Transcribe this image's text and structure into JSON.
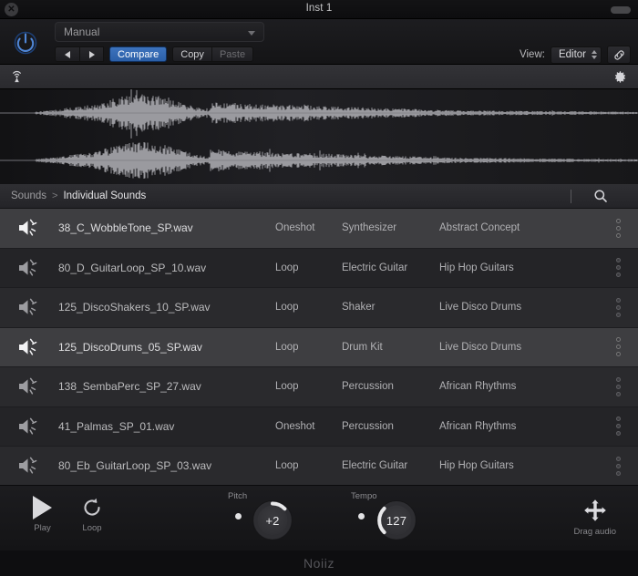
{
  "window": {
    "title": "Inst 1",
    "close_icon": "close-circle-icon",
    "resize_icon": "resize-pill-icon"
  },
  "plugin_header": {
    "power_icon": "power-icon",
    "preset": {
      "value": "Manual",
      "caret_icon": "chevron-down-icon"
    },
    "prev_icon": "triangle-left-icon",
    "next_icon": "triangle-right-icon",
    "compare_label": "Compare",
    "copy_label": "Copy",
    "paste_label": "Paste",
    "view_label": "View:",
    "view_value": "Editor",
    "view_stepper_icon": "up-down-arrows-icon",
    "link_icon": "link-chain-icon",
    "accent_color": "#2b5fa8"
  },
  "waveform": {
    "broadcast_icon": "broadcast-antenna-icon",
    "settings_icon": "gear-icon",
    "channels": 2,
    "wave_color": "#9a9a9f"
  },
  "browser": {
    "breadcrumb_root": "Sounds",
    "breadcrumb_separator": ">",
    "breadcrumb_current": "Individual Sounds",
    "search_icon": "search-icon"
  },
  "file_list": {
    "speaker_icon": "speaker-sound-icon",
    "menu_icon": "three-dots-vertical-icon",
    "rows": [
      {
        "name": "38_C_WobbleTone_SP.wav",
        "type": "Oneshot",
        "instrument": "Synthesizer",
        "category": "Abstract Concept",
        "selected": true
      },
      {
        "name": "80_D_GuitarLoop_SP_10.wav",
        "type": "Loop",
        "instrument": "Electric Guitar",
        "category": "Hip Hop Guitars",
        "selected": false
      },
      {
        "name": "125_DiscoShakers_10_SP.wav",
        "type": "Loop",
        "instrument": "Shaker",
        "category": "Live Disco Drums",
        "selected": false
      },
      {
        "name": "125_DiscoDrums_05_SP.wav",
        "type": "Loop",
        "instrument": "Drum Kit",
        "category": "Live Disco Drums",
        "selected": true
      },
      {
        "name": "138_SembaPerc_SP_27.wav",
        "type": "Loop",
        "instrument": "Percussion",
        "category": "African Rhythms",
        "selected": false
      },
      {
        "name": "41_Palmas_SP_01.wav",
        "type": "Oneshot",
        "instrument": "Percussion",
        "category": "African Rhythms",
        "selected": false
      },
      {
        "name": "80_Eb_GuitarLoop_SP_03.wav",
        "type": "Loop",
        "instrument": "Electric Guitar",
        "category": "Hip Hop Guitars",
        "selected": false
      }
    ]
  },
  "transport": {
    "play_label": "Play",
    "play_icon": "play-triangle-icon",
    "loop_label": "Loop",
    "loop_icon": "loop-circular-arrow-icon",
    "pitch_label": "Pitch",
    "pitch_value": "+2",
    "tempo_label": "Tempo",
    "tempo_value": "127",
    "drag_label": "Drag audio",
    "drag_icon": "move-four-arrows-icon"
  },
  "footer": {
    "brand": "Noiiz"
  }
}
